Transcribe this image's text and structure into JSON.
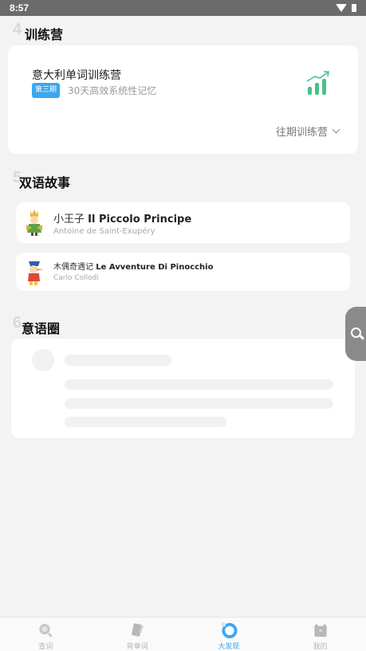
{
  "status_bar": {
    "time": "8:57"
  },
  "camp": {
    "section_number": "4",
    "section_title": "训练营",
    "title": "意大利单词训练营",
    "badge": "第三期",
    "subtitle": "30天高效系统性记忆",
    "past_link": "往期训练营"
  },
  "stories": {
    "section_number": "5",
    "section_title": "双语故事",
    "items": [
      {
        "title_cn": "小王子",
        "title_it": "Il Piccolo Principe",
        "author": "Antoine de Saint-Exupéry"
      },
      {
        "title_cn": "木偶奇遇记",
        "title_it": "Le Avventure Di Pinocchio",
        "author": "Carlo Collodi"
      }
    ]
  },
  "circle": {
    "section_number": "6",
    "section_title": "意语圈"
  },
  "tabbar": {
    "tabs": [
      {
        "label": "查词",
        "icon": "search-icon"
      },
      {
        "label": "背单词",
        "icon": "cards-icon"
      },
      {
        "label": "大发现",
        "icon": "discover-icon"
      },
      {
        "label": "我的",
        "icon": "profile-icon"
      }
    ],
    "active_index": 2
  },
  "colors": {
    "accent": "#3aa7f0",
    "chart_green": "#46c28a"
  }
}
